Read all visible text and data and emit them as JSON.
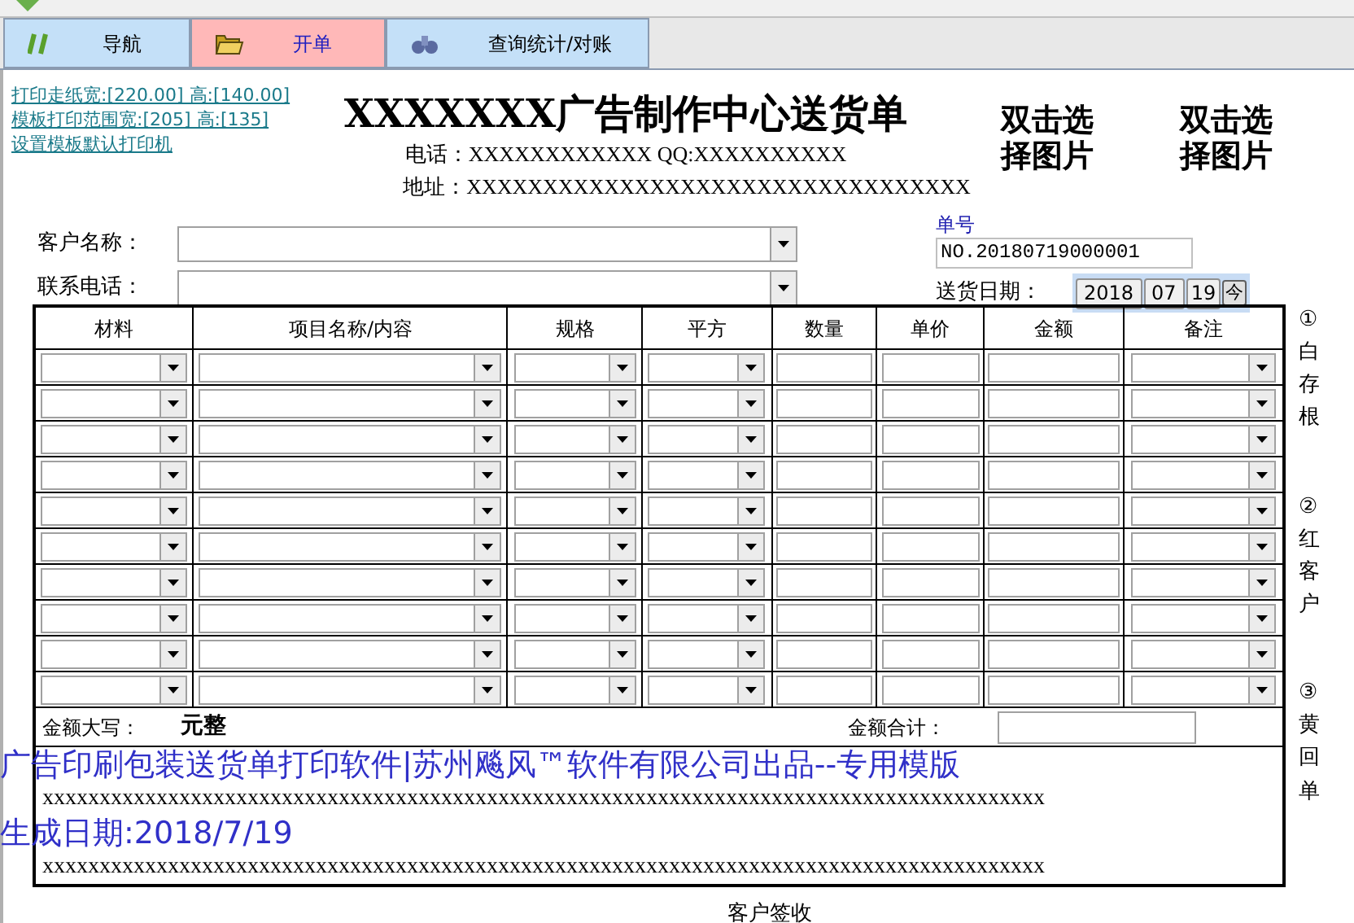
{
  "tabs": [
    {
      "label": "导航",
      "selected": false
    },
    {
      "label": "开单",
      "selected": true
    },
    {
      "label": "查询统计/对账",
      "selected": false
    }
  ],
  "print_links": [
    "打印走纸宽:[220.00] 高:[140.00]",
    "模板打印范围宽:[205] 高:[135]",
    "设置模板默认打印机"
  ],
  "header": {
    "title": "XXXXXXX广告制作中心送货单",
    "phone": "电话：XXXXXXXXXXXX QQ:XXXXXXXXXX",
    "address": "地址：XXXXXXXXXXXXXXXXXXXXXXXXXXXXXXXXX"
  },
  "image_slots": [
    "双击选择图片",
    "双击选择图片"
  ],
  "customer_fields": [
    {
      "label": "客户名称："
    },
    {
      "label": "联系电话："
    }
  ],
  "order_number": {
    "label": "单号",
    "value": "NO.20180719000001"
  },
  "delivery_date": {
    "label": "送货日期：",
    "year": "2018",
    "month": "07",
    "day": "19",
    "today_button": "今"
  },
  "table": {
    "columns": [
      {
        "label": "材料",
        "kind": "combo"
      },
      {
        "label": "项目名称/内容",
        "kind": "combo"
      },
      {
        "label": "规格",
        "kind": "combo"
      },
      {
        "label": "平方",
        "kind": "combo"
      },
      {
        "label": "数量",
        "kind": "input"
      },
      {
        "label": "单价",
        "kind": "input"
      },
      {
        "label": "金额",
        "kind": "input"
      },
      {
        "label": "备注",
        "kind": "combo"
      }
    ]
  },
  "totals": {
    "amount_in_words_label": "金额大写：",
    "amount_in_words": "元整",
    "total_label": "金额合计："
  },
  "remarks": [
    "xxxxxxxxxxxxxxxxxxxxxxxxxxxxxxxxxxxxxxxxxxxxxxxxxxxxxxxxxxxxxxxxxxxxxxxxxxxxxxxxxxxxxxxx",
    "xxxxxxxxxxxxxxxxxxxxxxxxxxxxxxxxxxxxxxxxxxxxxxxxxxxxxxxxxxxxxxxxxxxxxxxxxxxxxxxxxxxxxxxx"
  ],
  "copy_labels": [
    "①白存根",
    "②红客户",
    "③黄回单"
  ],
  "footer_overlay": [
    "广告印刷包装送货单打印软件|苏州飚风™软件有限公司出品--专用模版",
    "生成日期:2018/7/19"
  ],
  "signature": {
    "label": "客户签收"
  }
}
